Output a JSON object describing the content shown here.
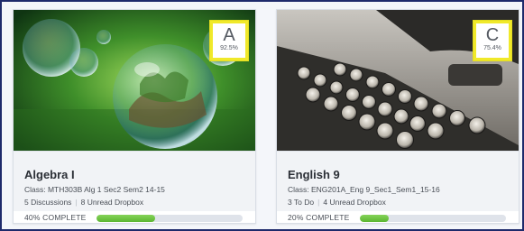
{
  "courses": [
    {
      "title": "Algebra I",
      "class_line": "Class: MTH303B Alg 1 Sec2 Sem2 14-15",
      "discussions": "5 Discussions",
      "dropbox": "8 Unread Dropbox",
      "progress_label": "40% COMPLETE",
      "progress": 0.4,
      "grade_letter": "A",
      "grade_percent": "92.5%",
      "image": "soap-bubbles-on-green"
    },
    {
      "title": "English 9",
      "class_line": "Class: ENG201A_Eng 9_Sec1_Sem1_15-16",
      "discussions": "3 To Do",
      "dropbox": "4 Unread Dropbox",
      "progress_label": "20% COMPLETE",
      "progress": 0.2,
      "grade_letter": "C",
      "grade_percent": "75.4%",
      "image": "vintage-typewriter"
    }
  ],
  "colors": {
    "progress_fill": "#5bb630",
    "grade_highlight": "#f0e92a",
    "frame_border": "#1e2a6b"
  }
}
